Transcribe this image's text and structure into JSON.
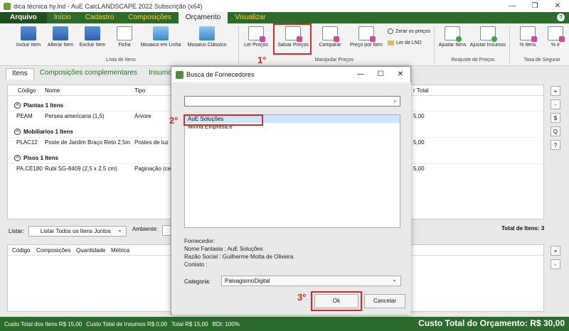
{
  "window": {
    "title": "dica técnica hy.lnd - AuE CalcLANDSCAPE 2022 Subscrição (x64)"
  },
  "tabs": [
    "Arquivo",
    "Início",
    "Cadastro",
    "Composições",
    "Orçamento",
    "Visualizar"
  ],
  "ribbon": {
    "buttons": [
      "Incluir Item",
      "Alterar Item",
      "Excluir Item",
      "Ficha",
      "Mosaico em Linha",
      "Mosaico Clássico",
      "Ler Preços",
      "Salvar Preços",
      "Comparar",
      "Preço por Item",
      "Ajustar Itens",
      "Ajustar Insumos",
      "% Itens",
      "% Ir"
    ],
    "links": [
      "Zerar os preços",
      "Ler de LND"
    ],
    "groups": [
      "Lista de Itens",
      "Manipular Preços",
      "Reajuste de Preços",
      "Taxa de Segurar"
    ]
  },
  "steps": [
    "1°",
    "2°",
    "3°"
  ],
  "main": {
    "subtabs": [
      "Itens",
      "Composições complementares",
      "Insumos"
    ],
    "columns": [
      "Código",
      "Nome",
      "Tipo",
      "r Total"
    ],
    "groups": [
      {
        "label": "Plantas  1 Itens",
        "row": {
          "code": "PEAM",
          "name": "Persea americana (1,5)",
          "type": "Árvore",
          "total": "5,00"
        }
      },
      {
        "label": "Mobiliarios  1 Itens",
        "row": {
          "code": "PLAC12",
          "name": "Poste de Jardim Braço Reto 2,5m",
          "type": "Postes de luz",
          "total": "5,00"
        }
      },
      {
        "label": "Pisos  1 Itens",
        "row": {
          "code": "PA.CE180",
          "name": "Rubi SG-8409 (2,5 x 2,5 cm)",
          "type": "Paginação (cer",
          "total": "5,00"
        }
      }
    ],
    "side_buttons": [
      "+",
      "-",
      "$",
      "Q",
      "?"
    ],
    "list_label": "Listar:",
    "list_value": "Listar Todos os Itens Juntos",
    "ambiente_label": "Ambiente:",
    "total_items": "Total de Itens: 3",
    "columns2": [
      "Código",
      "Composições",
      "Quantidade",
      "Métrica"
    ],
    "side_buttons2": [
      "+",
      "-"
    ]
  },
  "statusbar": {
    "items_total": "Custo Total dos Itens R$ 15,00",
    "insumos_total": "Custo Total de Insumos R$ 0,00",
    "total": "Total R$ 15,00",
    "bdi": "BDI: 100%",
    "grand": "Custo Total do Orçamento: R$ 30,00"
  },
  "dialog": {
    "title": "Busca de Fornecedores",
    "search_value": "",
    "list": [
      "AuE Soluções",
      "Minha Empresa.é"
    ],
    "info": [
      "Fornecedor:",
      "Nome Fantasia : AuE Soluções",
      "Razão Social : Guilherme Motta de Oliveira",
      "Contato :"
    ],
    "category_label": "Categoria:",
    "category_value": "PaisagismoDigital",
    "ok": "Ok",
    "cancel": "Cancelar"
  },
  "colors": {
    "brand_green": "#2d6b2d",
    "tab_yellow": "#ffd24a",
    "highlight_red": "#d42a2a"
  }
}
